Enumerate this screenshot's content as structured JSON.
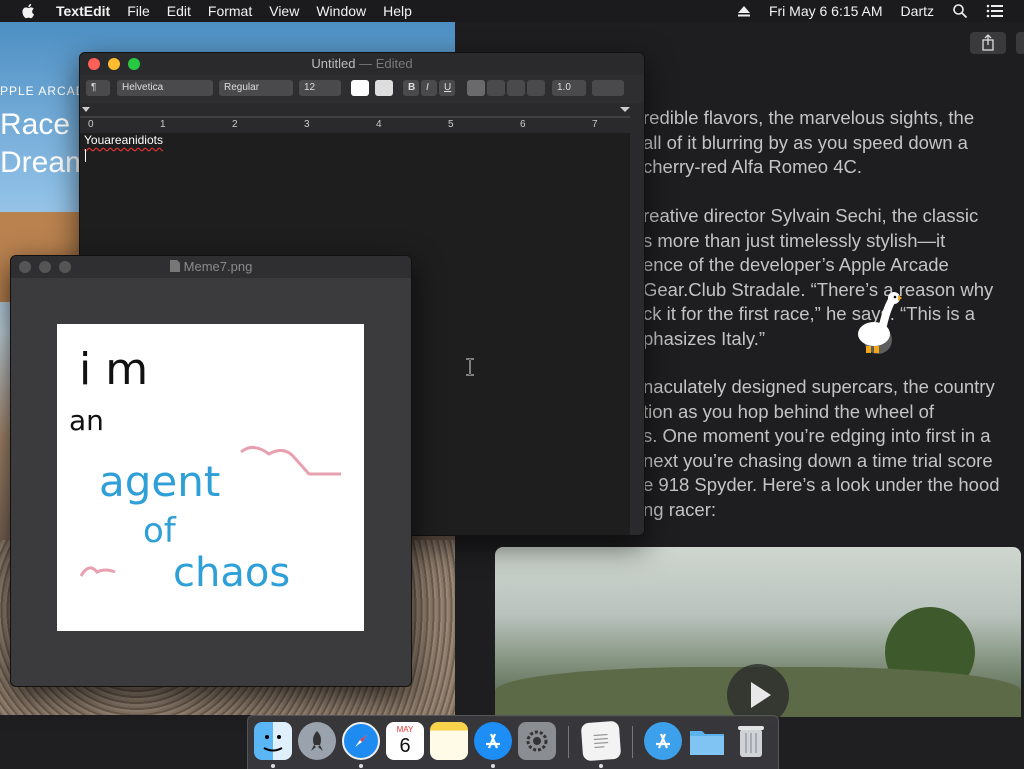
{
  "menubar": {
    "app_name": "TextEdit",
    "items": [
      "File",
      "Edit",
      "Format",
      "View",
      "Window",
      "Help"
    ],
    "clock": "Fri May 6  6:15 AM",
    "user": "Dartz"
  },
  "background_left": {
    "kicker": "PPLE ARCAD",
    "headline_1": "Race a",
    "headline_2": "Dream"
  },
  "article": {
    "paragraphs": [
      "redible flavors, the marvelous sights, the\nall of it blurring by as you speed down a\ncherry-red Alfa Romeo 4C.",
      "reative director Sylvain Sechi, the classic\ns more than just timelessly stylish—it\nence of the developer’s Apple Arcade\nGear.Club Stradale. “There’s a reason why\nck it for the first race,” he says. “This is a\nphasizes Italy.”",
      "naculately designed supercars, the country\ntion as you hop behind the wheel of\ns. One moment you’re edging into first in a\nnext you’re chasing down a time trial score\ne 918 Spyder. Here’s a look under the hood\nng racer:"
    ]
  },
  "textedit": {
    "title": "Untitled",
    "title_state": "— Edited",
    "paragraph_style": "¶",
    "font_family": "Helvetica",
    "font_style": "Regular",
    "font_size": "12",
    "bold": "B",
    "italic": "I",
    "underline": "U",
    "line_spacing": "1.0",
    "ruler_numbers": [
      "0",
      "1",
      "2",
      "3",
      "4",
      "5",
      "6",
      "7"
    ],
    "document_text": "Youareanidiots"
  },
  "preview": {
    "title": "Meme7.png",
    "meme_lines": [
      "i m",
      "an",
      "agent",
      "of",
      "chaos"
    ]
  },
  "dock": {
    "items": [
      "finder-icon",
      "launchpad-icon",
      "safari-icon",
      "calendar-icon",
      "notes-icon",
      "app-store-icon",
      "system-preferences-icon",
      "textedit-icon",
      "applications-folder-icon",
      "documents-folder-icon",
      "trash-icon"
    ],
    "calendar_month": "MAY",
    "calendar_day": "6"
  },
  "colors": {
    "close": "#fe5f57",
    "minimize": "#febc2e",
    "zoom": "#28c840",
    "ink_black": "#111111",
    "ink_blue": "#2f9fd8",
    "ink_pink": "#e8a0b0"
  }
}
